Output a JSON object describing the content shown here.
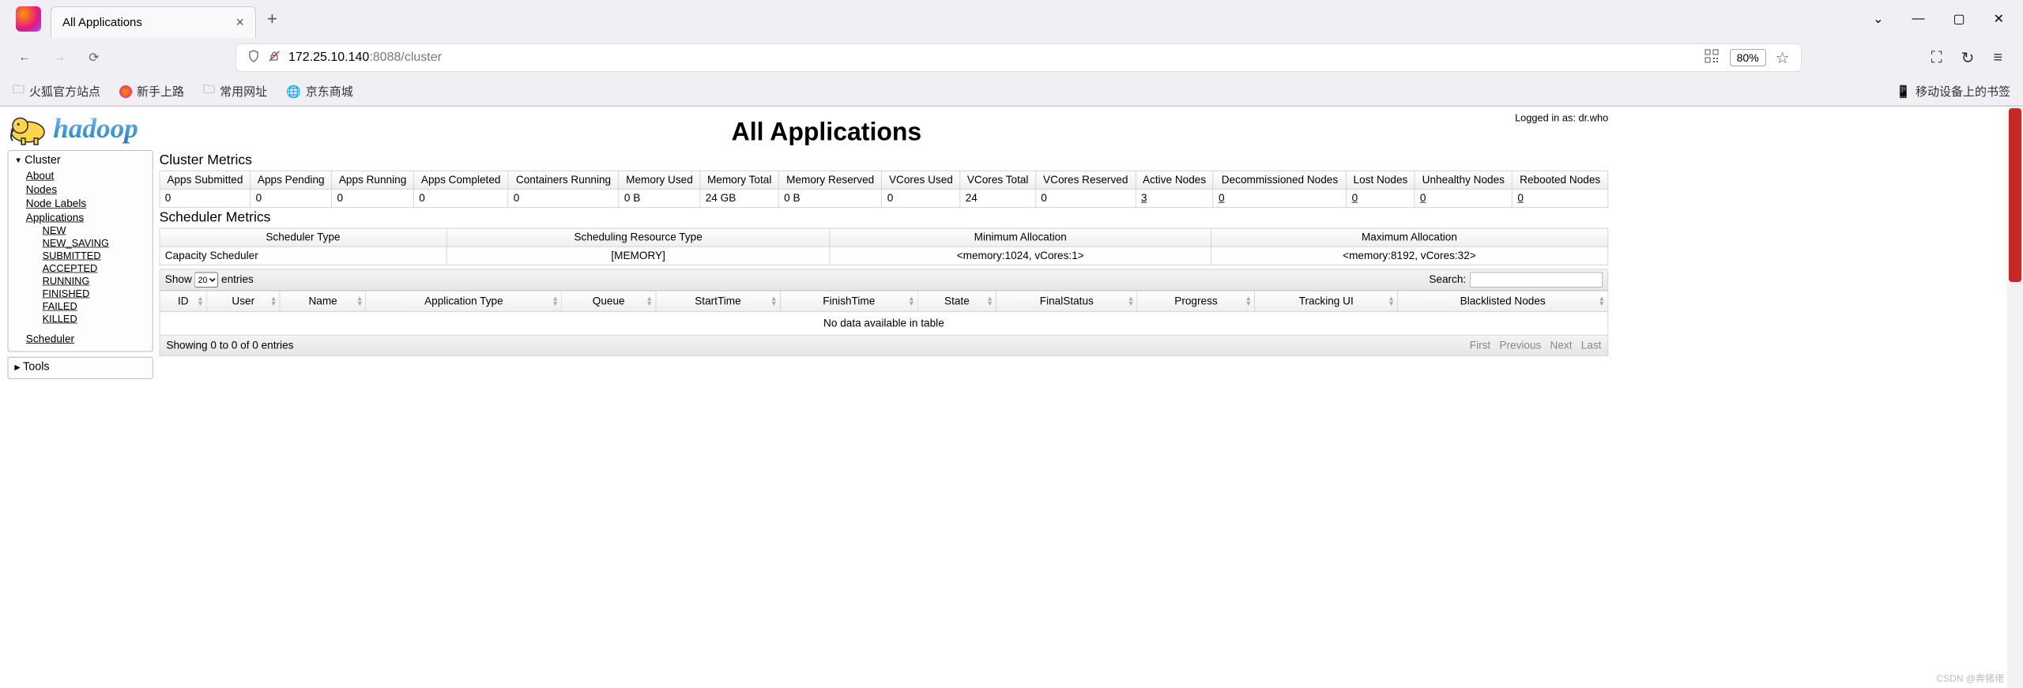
{
  "browser": {
    "tab_title": "All Applications",
    "new_tab": "+",
    "close_tab": "×",
    "window_caret": "⌄",
    "window_min": "—",
    "window_max": "▢",
    "window_close": "✕",
    "nav_back": "←",
    "nav_forward": "→",
    "nav_reload": "⟳",
    "url_host": "172.25.10.140",
    "url_port_path": ":8088/cluster",
    "zoom": "80%",
    "crop": "⛶",
    "undo": "↻",
    "menu": "≡"
  },
  "bookmarks": {
    "items": [
      {
        "label": "火狐官方站点",
        "icon": "folder"
      },
      {
        "label": "新手上路",
        "icon": "firefox"
      },
      {
        "label": "常用网址",
        "icon": "folder"
      },
      {
        "label": "京东商城",
        "icon": "globe"
      }
    ],
    "mobile": "移动设备上的书签"
  },
  "page": {
    "logo_text": "hadoop",
    "title": "All Applications",
    "login_prefix": "Logged in as: ",
    "login_user": "dr.who"
  },
  "sidebar": {
    "cluster_head": "Cluster",
    "tools_head": "Tools",
    "cluster_links": [
      "About",
      "Nodes",
      "Node Labels",
      "Applications"
    ],
    "app_states": [
      "NEW",
      "NEW_SAVING",
      "SUBMITTED",
      "ACCEPTED",
      "RUNNING",
      "FINISHED",
      "FAILED",
      "KILLED"
    ],
    "scheduler_link": "Scheduler"
  },
  "cluster_metrics": {
    "heading": "Cluster Metrics",
    "headers": [
      "Apps Submitted",
      "Apps Pending",
      "Apps Running",
      "Apps Completed",
      "Containers Running",
      "Memory Used",
      "Memory Total",
      "Memory Reserved",
      "VCores Used",
      "VCores Total",
      "VCores Reserved",
      "Active Nodes",
      "Decommissioned Nodes",
      "Lost Nodes",
      "Unhealthy Nodes",
      "Rebooted Nodes"
    ],
    "values": [
      "0",
      "0",
      "0",
      "0",
      "0",
      "0 B",
      "24 GB",
      "0 B",
      "0",
      "24",
      "0",
      "3",
      "0",
      "0",
      "0",
      "0"
    ],
    "links": [
      false,
      false,
      false,
      false,
      false,
      false,
      false,
      false,
      false,
      false,
      false,
      true,
      true,
      true,
      true,
      true
    ]
  },
  "scheduler_metrics": {
    "heading": "Scheduler Metrics",
    "headers": [
      "Scheduler Type",
      "Scheduling Resource Type",
      "Minimum Allocation",
      "Maximum Allocation"
    ],
    "values": [
      "Capacity Scheduler",
      "[MEMORY]",
      "<memory:1024, vCores:1>",
      "<memory:8192, vCores:32>"
    ]
  },
  "datatable": {
    "show_prefix": "Show",
    "show_value": "20",
    "show_suffix": "entries",
    "search_label": "Search:",
    "columns": [
      "ID",
      "User",
      "Name",
      "Application Type",
      "Queue",
      "StartTime",
      "FinishTime",
      "State",
      "FinalStatus",
      "Progress",
      "Tracking UI",
      "Blacklisted Nodes"
    ],
    "empty": "No data available in table",
    "info": "Showing 0 to 0 of 0 entries",
    "pager": [
      "First",
      "Previous",
      "Next",
      "Last"
    ]
  },
  "watermark": "CSDN @奔猪佬"
}
